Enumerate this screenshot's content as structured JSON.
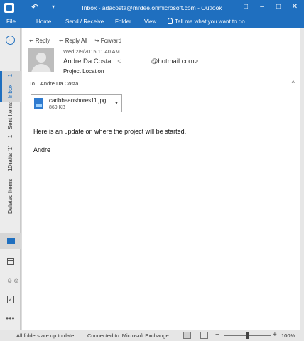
{
  "window": {
    "title": "Inbox - adacosta@mrdee.onmicrosoft.com - Outlook",
    "undo_glyph": "↶",
    "qa_glyph": "▾",
    "minimize_glyph": "–",
    "restore_glyph": "□",
    "close_glyph": "✕",
    "accent_color": "#1f6fbf"
  },
  "ribbon": {
    "tabs": [
      "File",
      "Home",
      "Send / Receive",
      "Folder",
      "View"
    ],
    "tell_me": "Tell me what you want to do..."
  },
  "nav": {
    "back_glyph": "←",
    "folders": [
      {
        "label": "Inbox",
        "count": "1"
      },
      {
        "label": "Sent Items",
        "count": ""
      },
      {
        "label": "Drafts [1]",
        "count": "1"
      },
      {
        "label": "Deleted Items",
        "count": "1"
      }
    ],
    "more_glyph": "•••",
    "people_glyph": "☺☺",
    "tasks_glyph": "✓"
  },
  "message": {
    "actions": {
      "reply": "Reply",
      "reply_all": "Reply All",
      "forward": "Forward"
    },
    "action_icons": {
      "reply": "↩",
      "reply_all": "↩",
      "forward": "↪"
    },
    "date": "Wed 2/9/2015 11:40 AM",
    "sender_name": "Andre Da Costa",
    "sender_email_open": "<",
    "sender_email_rest": "@hotmail.com>",
    "subject": "Project Location",
    "to_label": "To",
    "to_value": "Andre Da Costa",
    "collapse_glyph": "˄",
    "attachment": {
      "name": "caribbeanshores11.jpg",
      "size": "869 KB",
      "dropdown_glyph": "▼"
    },
    "body_lines": [
      "Here is an update on where the project will be started.",
      "Andre"
    ]
  },
  "status": {
    "left": "All folders are up to date.",
    "connection": "Connected to: Microsoft Exchange",
    "zoom_minus": "−",
    "zoom_plus": "+",
    "zoom": "100%",
    "zoom_level": 0.5
  }
}
